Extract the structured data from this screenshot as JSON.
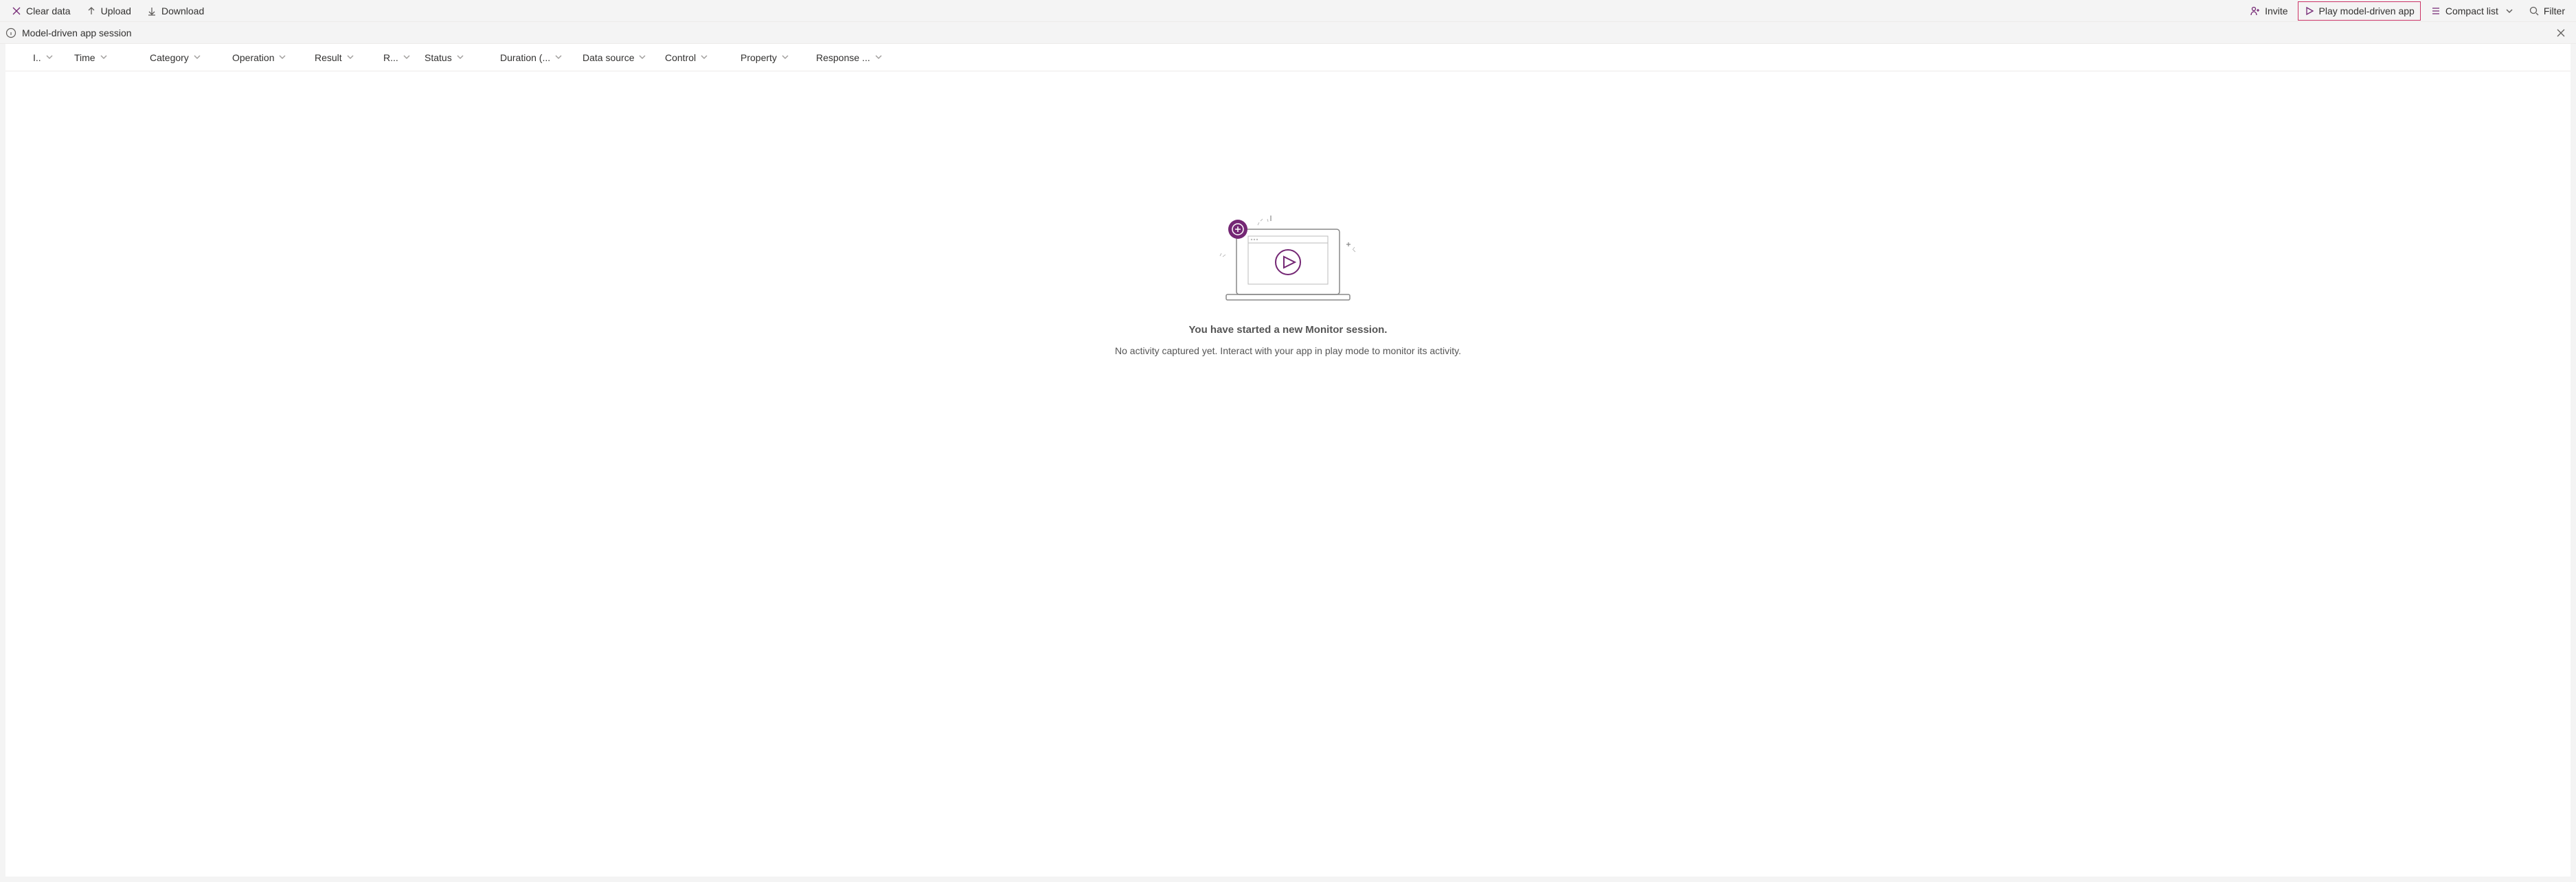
{
  "toolbar": {
    "left": {
      "clear_data": "Clear data",
      "upload": "Upload",
      "download": "Download"
    },
    "right": {
      "invite": "Invite",
      "play_app": "Play model-driven app",
      "compact_list": "Compact list",
      "filter": "Filter"
    }
  },
  "infobar": {
    "text": "Model-driven app session"
  },
  "columns": {
    "id": "I..",
    "time": "Time",
    "category": "Category",
    "operation": "Operation",
    "result": "Result",
    "r": "R...",
    "status": "Status",
    "duration": "Duration (...",
    "data_source": "Data source",
    "control": "Control",
    "property": "Property",
    "response": "Response ..."
  },
  "empty": {
    "title": "You have started a new Monitor session.",
    "subtitle": "No activity captured yet. Interact with your app in play mode to monitor its activity."
  }
}
